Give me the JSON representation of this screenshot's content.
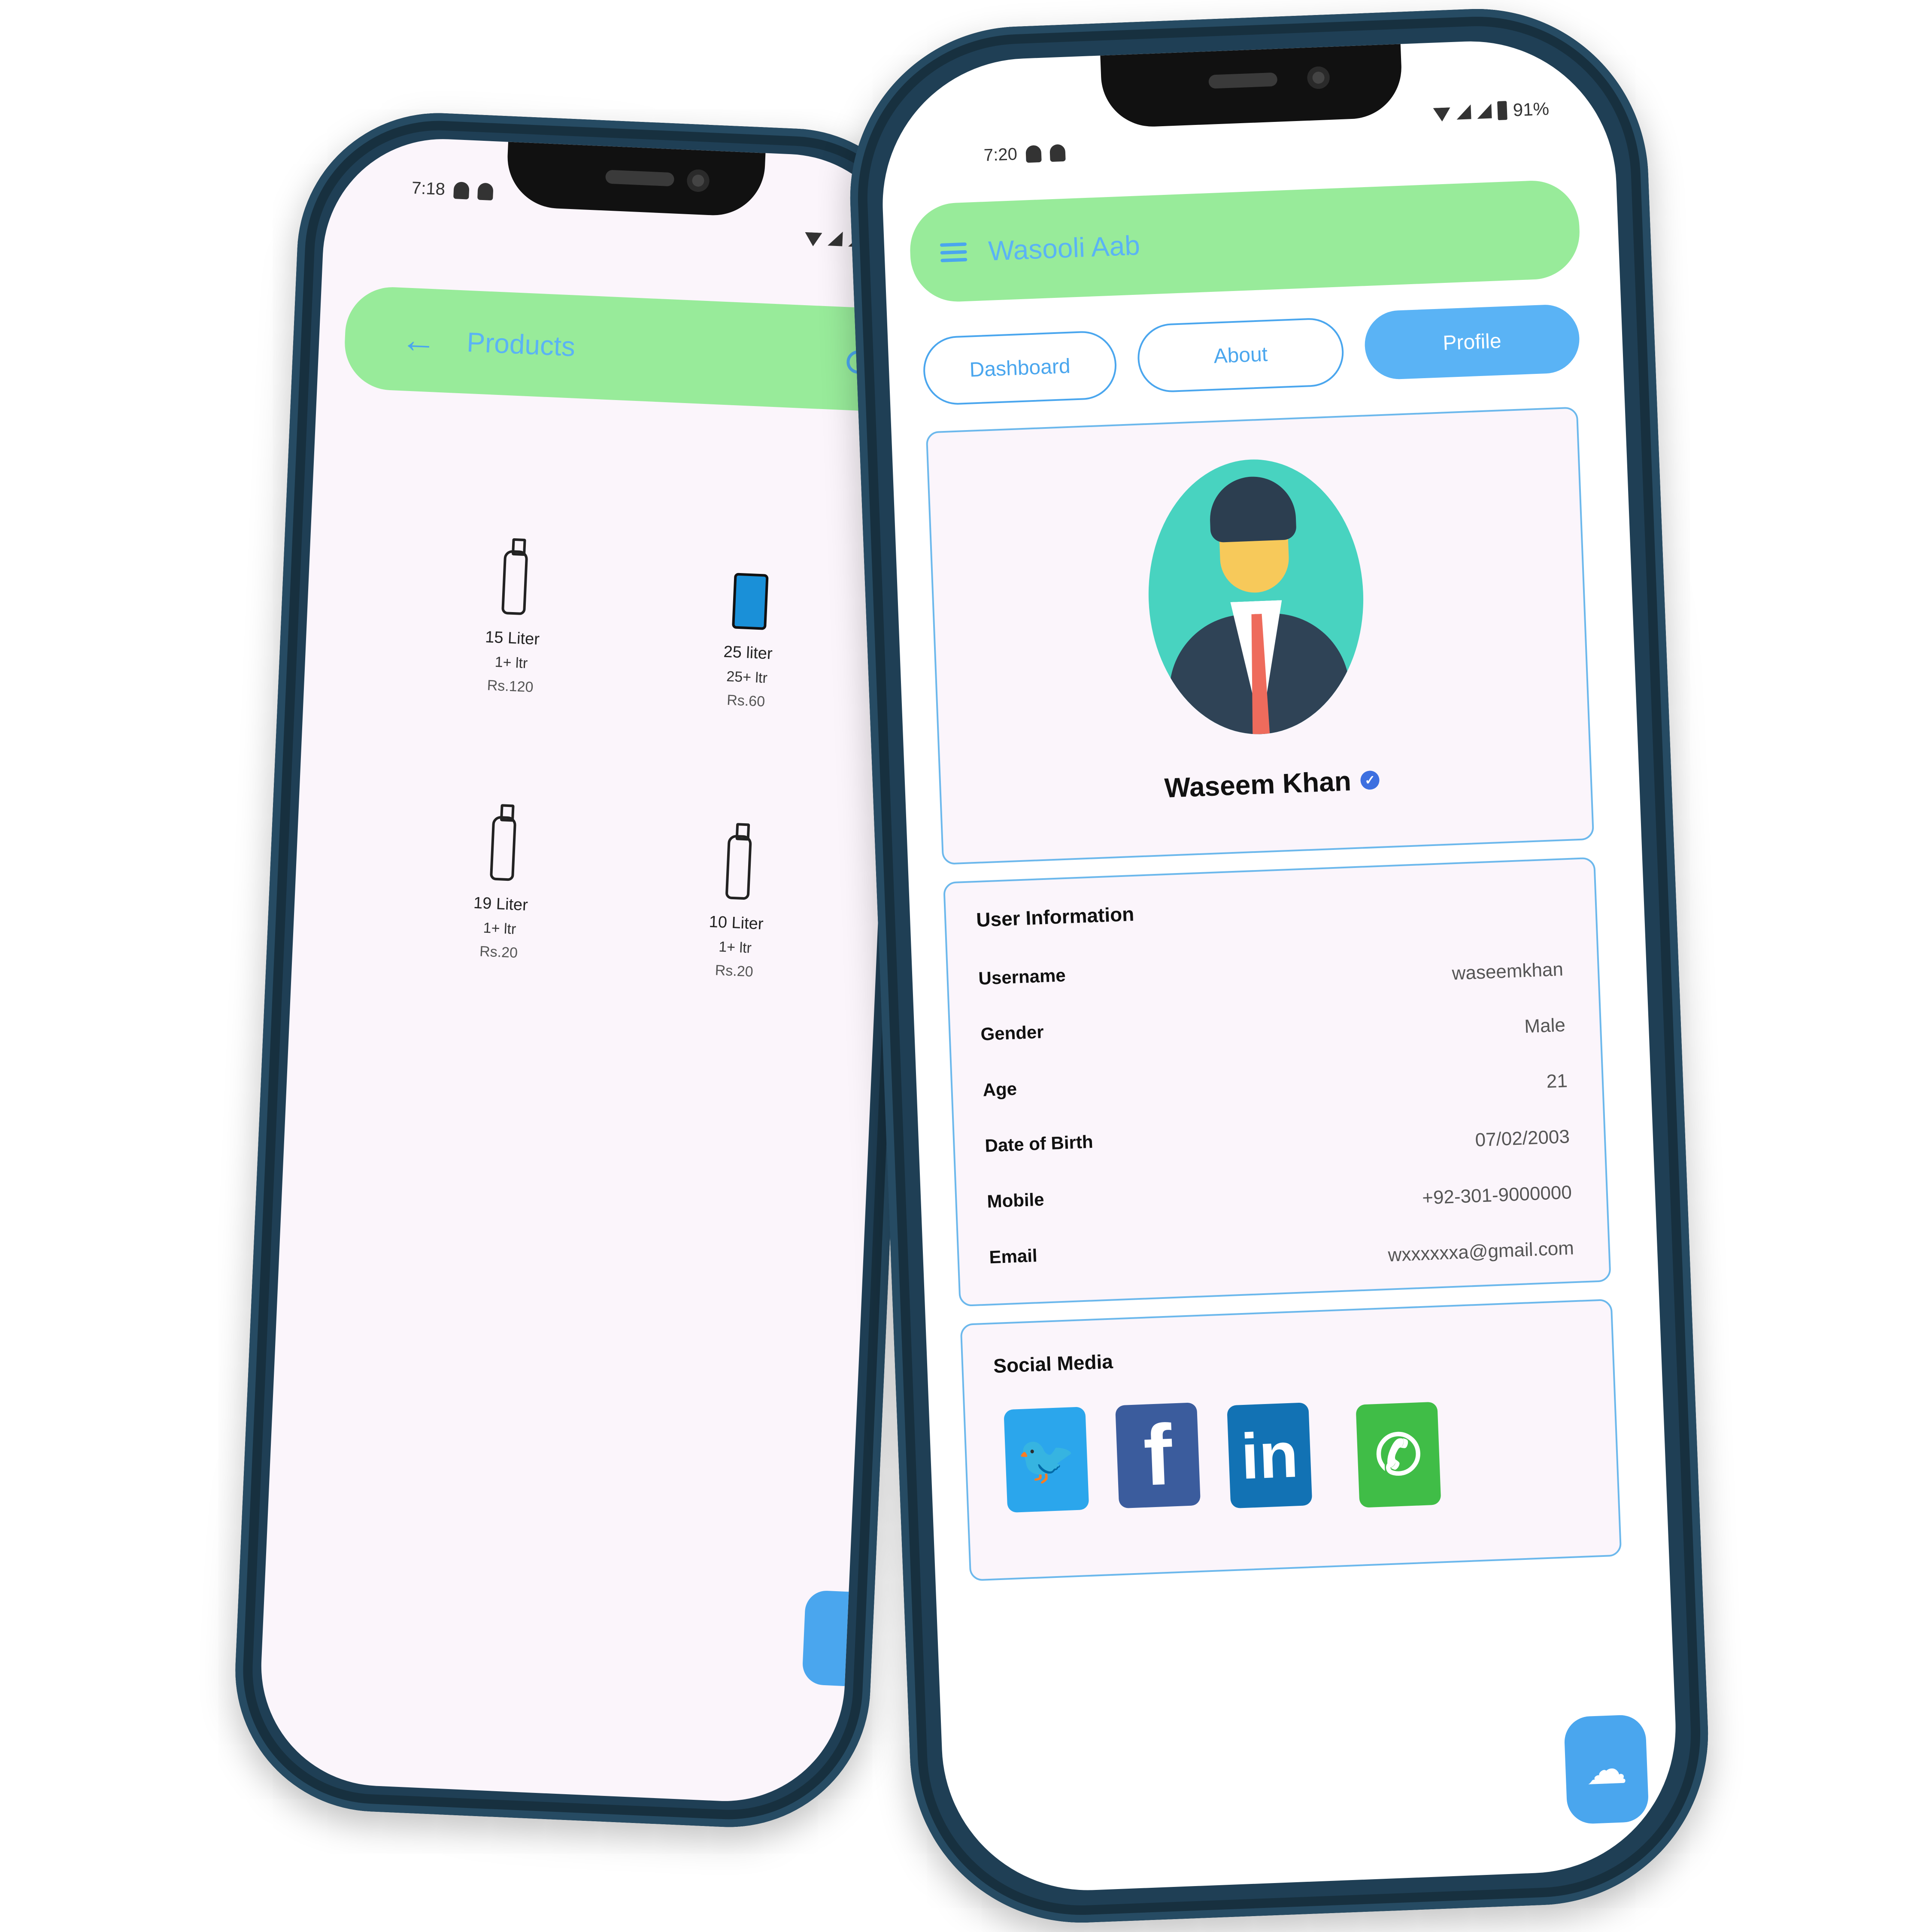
{
  "left_phone": {
    "status": {
      "time": "7:18"
    },
    "appbar": {
      "title": "Products"
    },
    "products": [
      {
        "name": "15 Liter",
        "size": "1+ ltr",
        "price": "Rs.120",
        "icon": "bottle-icon"
      },
      {
        "name": "25 liter",
        "size": "25+ ltr",
        "price": "Rs.60",
        "icon": "water-can-icon"
      },
      {
        "name": "19 Liter",
        "size": "1+ ltr",
        "price": "Rs.20",
        "icon": "bottle-icon"
      },
      {
        "name": "10 Liter",
        "size": "1+ ltr",
        "price": "Rs.20",
        "icon": "bottle-icon"
      }
    ]
  },
  "right_phone": {
    "status": {
      "time": "7:20",
      "battery": "91%"
    },
    "appbar": {
      "title": "Wasooli Aab"
    },
    "tabs": [
      {
        "label": "Dashboard",
        "active": false
      },
      {
        "label": "About",
        "active": false
      },
      {
        "label": "Profile",
        "active": true
      }
    ],
    "profile": {
      "name": "Waseem Khan",
      "verified": true
    },
    "user_info": {
      "title": "User Information",
      "rows": [
        {
          "label": "Username",
          "value": "waseemkhan"
        },
        {
          "label": "Gender",
          "value": "Male"
        },
        {
          "label": "Age",
          "value": "21"
        },
        {
          "label": "Date of Birth",
          "value": "07/02/2003"
        },
        {
          "label": "Mobile",
          "value": "+92-301-9000000"
        },
        {
          "label": "Email",
          "value": "wxxxxxxa@gmail.com"
        }
      ]
    },
    "social": {
      "title": "Social Media",
      "items": [
        {
          "name": "twitter",
          "glyph": "🐦",
          "color": "#2ba6ec"
        },
        {
          "name": "facebook",
          "glyph": "f",
          "color": "#3b5c9d"
        },
        {
          "name": "linkedin",
          "glyph": "in",
          "color": "#1272b4"
        },
        {
          "name": "whatsapp",
          "glyph": "✆",
          "color": "#40bd47"
        }
      ]
    }
  },
  "colors": {
    "appbar": "#98eb9a",
    "accent": "#4aa6ee",
    "screen_bg": "#fbf5fb",
    "frame": "#1f3f55"
  }
}
